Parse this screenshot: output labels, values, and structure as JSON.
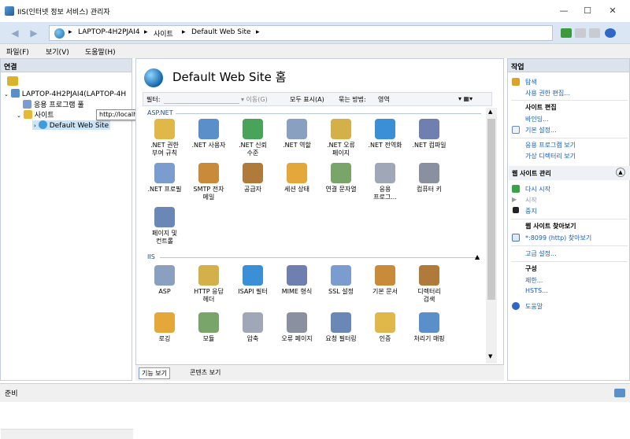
{
  "window": {
    "title": "IIS(인터넷 정보 서비스) 관리자",
    "min": "—",
    "max": "☐",
    "close": "✕"
  },
  "address": {
    "crumbs": [
      "LAPTOP-4H2PJAI4",
      "사이트",
      "Default Web Site"
    ],
    "separator": "▸"
  },
  "menu": [
    "파일(F)",
    "보기(V)",
    "도움말(H)"
  ],
  "connections": {
    "title": "연결",
    "tree": [
      "LAPTOP-4H2PJAI4(LAPTOP-4H",
      "응용 프로그램 풀",
      "사이트",
      "Default Web Site"
    ],
    "tooltip": "http://localhost/"
  },
  "home": {
    "title": "Default Web Site 홈",
    "filter_label": "필터:",
    "go": "▾ 이동(G)",
    "show_all": "모두 표시(A)",
    "group_by": "묶는 방법:",
    "group_value": "영역",
    "groups": [
      {
        "label": "ASP.NET",
        "items": [
          ".NET 권한\n부여 규칙",
          ".NET 사용자",
          ".NET 신뢰\n수준",
          ".NET 역할",
          ".NET 오류\n페이지",
          ".NET 전역화",
          ".NET 컴파일",
          ".NET 프로필",
          "SMTP 전자\n메일",
          "공급자",
          "세션 상태",
          "연결 문자열",
          "응용\n프로그...",
          "컴퓨터 키",
          "페이지 및\n컨트롤"
        ]
      },
      {
        "label": "IIS",
        "items": [
          "ASP",
          "HTTP 응답\n헤더",
          "ISAPI 필터",
          "MIME 형식",
          "SSL 설정",
          "기본 문서",
          "디렉터리\n검색",
          "로깅",
          "모듈",
          "압축",
          "오류 페이지",
          "요청 필터링",
          "인증",
          "처리기 매핑"
        ]
      }
    ]
  },
  "view_tabs": [
    "기능 보기",
    "콘텐츠 보기"
  ],
  "actions": {
    "title": "작업",
    "explore": "탐색",
    "edit_perms": "사용 권한 편집...",
    "site_edit_header": "사이트 편집",
    "bindings": "바인딩...",
    "basic_settings": "기본 설정...",
    "view_apps": "응용 프로그램 보기",
    "view_vdirs": "가상 디렉터리 보기",
    "manage_header": "웹 사이트 관리",
    "restart": "다시 시작",
    "start": "시작",
    "stop": "중지",
    "browse_header": "웹 사이트 찾아보기",
    "browse_link": "*:8099 (http) 찾아보기",
    "advanced": "고급 설정...",
    "config_header": "구성",
    "limits": "제한...",
    "hsts": "HSTS...",
    "help": "도움말"
  },
  "status": "준비"
}
